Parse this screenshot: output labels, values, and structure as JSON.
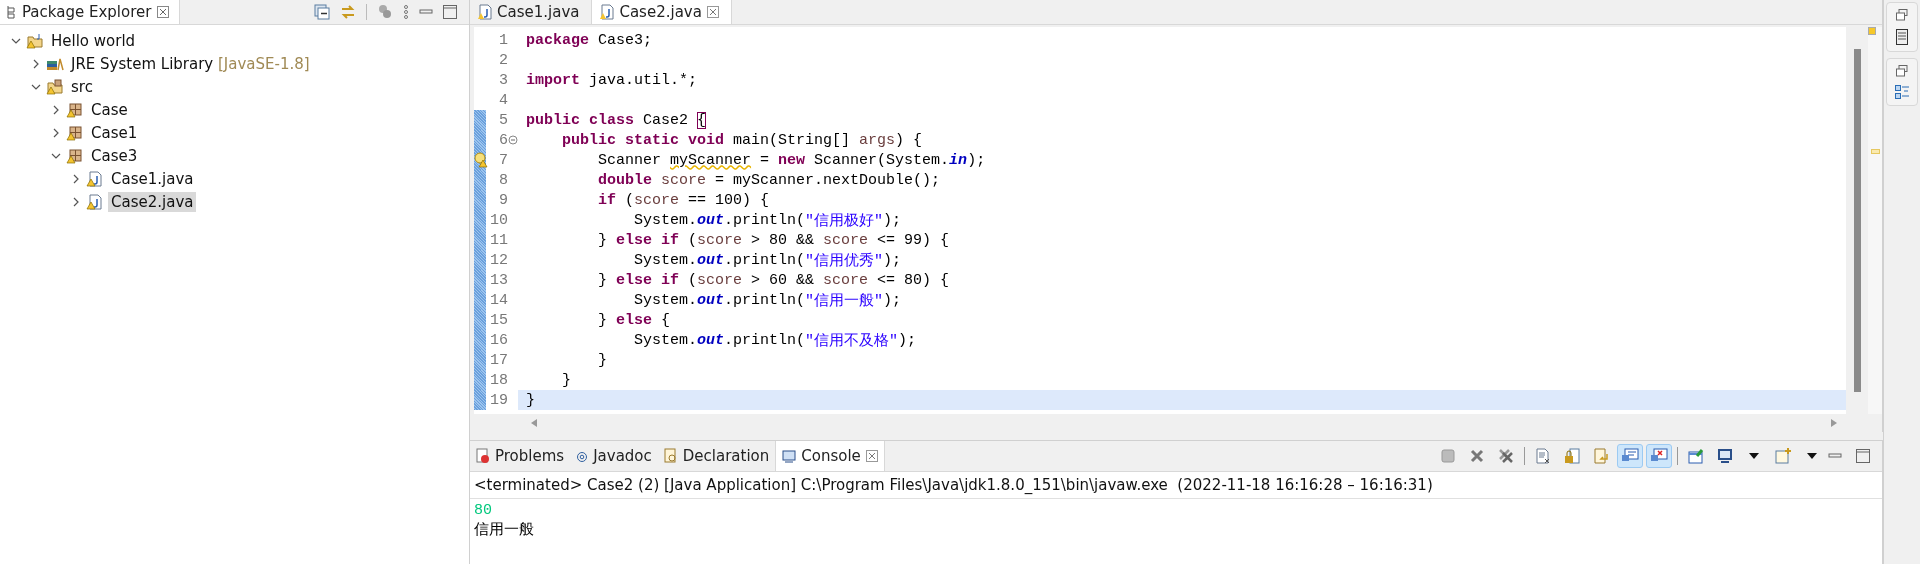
{
  "package_explorer": {
    "title": "Package Explorer",
    "tree": [
      {
        "kind": "project",
        "label": "Hello world",
        "expanded": true,
        "selected": false,
        "children": [
          {
            "kind": "library",
            "label": "JRE System Library",
            "decoration": "[JavaSE-1.8]",
            "expanded": false,
            "selected": false
          },
          {
            "kind": "source-folder",
            "label": "src",
            "expanded": true,
            "selected": false,
            "children": [
              {
                "kind": "package",
                "label": "Case",
                "expanded": false,
                "selected": false
              },
              {
                "kind": "package",
                "label": "Case1",
                "expanded": false,
                "selected": false
              },
              {
                "kind": "package",
                "label": "Case3",
                "expanded": true,
                "selected": false,
                "children": [
                  {
                    "kind": "java-file",
                    "label": "Case1.java",
                    "expanded": false,
                    "selected": false
                  },
                  {
                    "kind": "java-file",
                    "label": "Case2.java",
                    "expanded": false,
                    "selected": true
                  }
                ]
              }
            ]
          }
        ]
      }
    ]
  },
  "editor": {
    "tabs": [
      {
        "label": "Case1.java",
        "selected": false
      },
      {
        "label": "Case2.java",
        "selected": true
      }
    ],
    "lines": [
      {
        "number": "1",
        "changed": false,
        "current": false,
        "warning": false,
        "foldable": false,
        "tokens": [
          {
            "kind": "keyword",
            "text": "package"
          },
          {
            "kind": "plain",
            "text": " Case3;"
          }
        ]
      },
      {
        "number": "2",
        "changed": false,
        "current": false,
        "warning": false,
        "foldable": false
      },
      {
        "number": "3",
        "changed": false,
        "current": false,
        "warning": false,
        "foldable": false,
        "tokens": [
          {
            "kind": "keyword",
            "text": "import"
          },
          {
            "kind": "plain",
            "text": " java.util.*;"
          }
        ]
      },
      {
        "number": "4",
        "changed": false,
        "current": false,
        "warning": false,
        "foldable": false
      },
      {
        "number": "5",
        "changed": true,
        "current": false,
        "warning": false,
        "foldable": false,
        "tokens": [
          {
            "kind": "keyword",
            "text": "public class"
          },
          {
            "kind": "plain",
            "text": " Case2 "
          },
          {
            "kind": "bracket",
            "text": "{"
          }
        ]
      },
      {
        "number": "6",
        "changed": true,
        "current": false,
        "warning": false,
        "foldable": true,
        "tokens": [
          {
            "kind": "keyword",
            "text": "    public static void"
          },
          {
            "kind": "plain",
            "text": " main(String[] "
          },
          {
            "kind": "local",
            "text": "args"
          },
          {
            "kind": "plain",
            "text": ") {"
          }
        ]
      },
      {
        "number": "7",
        "changed": true,
        "current": false,
        "warning": true,
        "foldable": false,
        "tokens": [
          {
            "kind": "plain",
            "text": "        Scanner "
          },
          {
            "kind": "unused",
            "text": "myScanner"
          },
          {
            "kind": "plain",
            "text": " = "
          },
          {
            "kind": "keyword",
            "text": "new"
          },
          {
            "kind": "plain",
            "text": " Scanner(System."
          },
          {
            "kind": "field",
            "text": "in"
          },
          {
            "kind": "plain",
            "text": ");"
          }
        ]
      },
      {
        "number": "8",
        "changed": true,
        "current": false,
        "warning": false,
        "foldable": false,
        "tokens": [
          {
            "kind": "keyword",
            "text": "        double"
          },
          {
            "kind": "local",
            "text": " score"
          },
          {
            "kind": "plain",
            "text": " = myScanner.nextDouble();"
          }
        ]
      },
      {
        "number": "9",
        "changed": true,
        "current": false,
        "warning": false,
        "foldable": false,
        "tokens": [
          {
            "kind": "keyword",
            "text": "        if"
          },
          {
            "kind": "plain",
            "text": " ("
          },
          {
            "kind": "local",
            "text": "score"
          },
          {
            "kind": "plain",
            "text": " == 100) {"
          }
        ]
      },
      {
        "number": "10",
        "changed": true,
        "current": false,
        "warning": false,
        "foldable": false,
        "tokens": [
          {
            "kind": "plain",
            "text": "            System."
          },
          {
            "kind": "field",
            "text": "out"
          },
          {
            "kind": "plain",
            "text": ".println("
          },
          {
            "kind": "string",
            "text": "\"信用极好\""
          },
          {
            "kind": "plain",
            "text": ");"
          }
        ]
      },
      {
        "number": "11",
        "changed": true,
        "current": false,
        "warning": false,
        "foldable": false,
        "tokens": [
          {
            "kind": "plain",
            "text": "        } "
          },
          {
            "kind": "keyword",
            "text": "else if"
          },
          {
            "kind": "plain",
            "text": " ("
          },
          {
            "kind": "local",
            "text": "score"
          },
          {
            "kind": "plain",
            "text": " > 80 && "
          },
          {
            "kind": "local",
            "text": "score"
          },
          {
            "kind": "plain",
            "text": " <= 99) {"
          }
        ]
      },
      {
        "number": "12",
        "changed": true,
        "current": false,
        "warning": false,
        "foldable": false,
        "tokens": [
          {
            "kind": "plain",
            "text": "            System."
          },
          {
            "kind": "field",
            "text": "out"
          },
          {
            "kind": "plain",
            "text": ".println("
          },
          {
            "kind": "string",
            "text": "\"信用优秀\""
          },
          {
            "kind": "plain",
            "text": ");"
          }
        ]
      },
      {
        "number": "13",
        "changed": true,
        "current": false,
        "warning": false,
        "foldable": false,
        "tokens": [
          {
            "kind": "plain",
            "text": "        } "
          },
          {
            "kind": "keyword",
            "text": "else if"
          },
          {
            "kind": "plain",
            "text": " ("
          },
          {
            "kind": "local",
            "text": "score"
          },
          {
            "kind": "plain",
            "text": " > 60 && "
          },
          {
            "kind": "local",
            "text": "score"
          },
          {
            "kind": "plain",
            "text": " <= 80) {"
          }
        ]
      },
      {
        "number": "14",
        "changed": true,
        "current": false,
        "warning": false,
        "foldable": false,
        "tokens": [
          {
            "kind": "plain",
            "text": "            System."
          },
          {
            "kind": "field",
            "text": "out"
          },
          {
            "kind": "plain",
            "text": ".println("
          },
          {
            "kind": "string",
            "text": "\"信用一般\""
          },
          {
            "kind": "plain",
            "text": ");"
          }
        ]
      },
      {
        "number": "15",
        "changed": true,
        "current": false,
        "warning": false,
        "foldable": false,
        "tokens": [
          {
            "kind": "plain",
            "text": "        } "
          },
          {
            "kind": "keyword",
            "text": "else"
          },
          {
            "kind": "plain",
            "text": " {"
          }
        ]
      },
      {
        "number": "16",
        "changed": true,
        "current": false,
        "warning": false,
        "foldable": false,
        "tokens": [
          {
            "kind": "plain",
            "text": "            System."
          },
          {
            "kind": "field",
            "text": "out"
          },
          {
            "kind": "plain",
            "text": ".println("
          },
          {
            "kind": "string",
            "text": "\"信用不及格\""
          },
          {
            "kind": "plain",
            "text": ");"
          }
        ]
      },
      {
        "number": "17",
        "changed": true,
        "current": false,
        "warning": false,
        "foldable": false,
        "tokens": [
          {
            "kind": "plain",
            "text": "        }"
          }
        ]
      },
      {
        "number": "18",
        "changed": true,
        "current": false,
        "warning": false,
        "foldable": false,
        "tokens": [
          {
            "kind": "plain",
            "text": "    }"
          }
        ]
      },
      {
        "number": "19",
        "changed": true,
        "current": true,
        "warning": false,
        "foldable": false,
        "tokens": [
          {
            "kind": "plain",
            "text": "}"
          }
        ]
      }
    ]
  },
  "console_panel": {
    "tabs": [
      {
        "kind": "problems",
        "label": "Problems",
        "selected": false
      },
      {
        "kind": "javadoc",
        "label": "Javadoc",
        "selected": false
      },
      {
        "kind": "declaration",
        "label": "Declaration",
        "selected": false
      },
      {
        "kind": "console",
        "label": "Console",
        "selected": true
      }
    ],
    "toolbar": [
      {
        "kind": "terminate",
        "pressed": false
      },
      {
        "kind": "remove-launch",
        "pressed": false
      },
      {
        "kind": "remove-all",
        "pressed": false
      },
      {
        "kind": "separator"
      },
      {
        "kind": "clear",
        "pressed": false
      },
      {
        "kind": "scroll-lock",
        "pressed": false
      },
      {
        "kind": "word-wrap",
        "pressed": false
      },
      {
        "kind": "show-on-output",
        "pressed": true
      },
      {
        "kind": "show-on-error",
        "pressed": true
      },
      {
        "kind": "separator"
      },
      {
        "kind": "pin",
        "pressed": false
      },
      {
        "kind": "display-console",
        "pressed": false
      },
      {
        "kind": "dropdown",
        "pressed": false
      },
      {
        "kind": "open-console",
        "pressed": false
      },
      {
        "kind": "dropdown",
        "pressed": false
      }
    ],
    "header": "<terminated> Case2 (2) [Java Application] C:\\Program Files\\Java\\jdk1.8.0_151\\bin\\javaw.exe  (2022-11-18 16:16:28 – 16:16:31)",
    "output": [
      {
        "kind": "input",
        "text": "80"
      },
      {
        "kind": "output",
        "text": "信用一般"
      }
    ]
  }
}
